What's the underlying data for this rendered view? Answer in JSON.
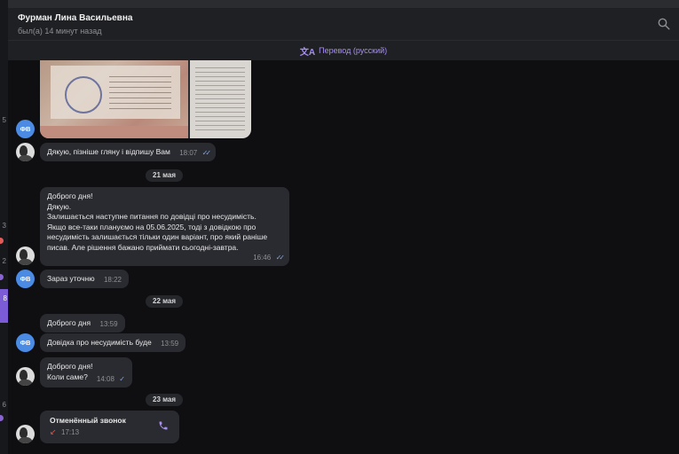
{
  "sidebar_strip": {
    "numbers": [
      "5",
      "3",
      "2",
      "6"
    ],
    "active_label": "8"
  },
  "header": {
    "contact_name": "Фурман Лина Васильевна",
    "status": "был(а) 14 минут назад",
    "search_icon": "search-icon"
  },
  "translate_bar": {
    "label": "Перевод (русский)",
    "icon": "translate-icon"
  },
  "messages": {
    "m1": {
      "text": "Дякую, пізніше гляну і відпишу Вам",
      "time": "18:07",
      "read": true
    },
    "date1": "21 мая",
    "m2": {
      "text": "Доброго дня!\nДякую.\nЗалишається наступне питання по довідці про несудимість.\nЯкщо все-таки плануємо на 05.06.2025, тоді з довідкою про\nнесудимість залишається тільки один варіант, про який раніше\nписав. Але рішення бажано приймати сьогодні-завтра.",
      "time": "16:46",
      "read": true
    },
    "m3": {
      "text": "Зараз уточню",
      "time": "18:22"
    },
    "date2": "22 мая",
    "m4": {
      "text": "Доброго дня",
      "time": "13:59"
    },
    "m5": {
      "text": "Довідка про несудимість буде",
      "time": "13:59"
    },
    "m6": {
      "text": "Доброго дня!\nКоли саме?",
      "time": "14:08",
      "read": true
    },
    "date3": "23 мая",
    "call": {
      "title": "Отменённый звонок",
      "time": "17:13",
      "icon": "phone-icon"
    }
  },
  "avatars": {
    "fv_initials": "ФВ"
  },
  "colors": {
    "accent": "#a88ef5",
    "avatar_blue": "#4c8be3",
    "bubble": "#2a2b30",
    "missed_call_red": "#e05a4e"
  }
}
